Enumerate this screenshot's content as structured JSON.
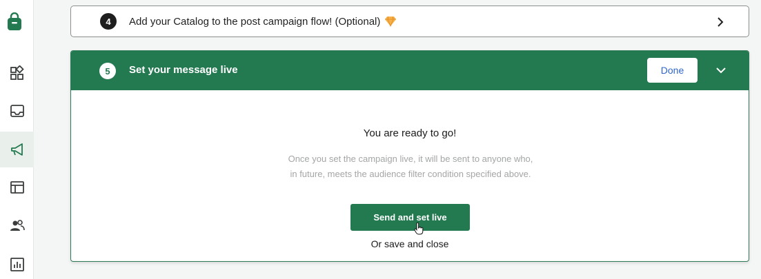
{
  "sidebar": {
    "logo_icon": "shopping-bag-icon",
    "items": [
      {
        "icon": "apps-grid-icon",
        "active": false
      },
      {
        "icon": "inbox-icon",
        "active": false
      },
      {
        "icon": "megaphone-icon",
        "active": true
      },
      {
        "icon": "table-icon",
        "active": false
      },
      {
        "icon": "users-icon",
        "active": false
      },
      {
        "icon": "bar-chart-icon",
        "active": false
      }
    ]
  },
  "steps": {
    "step4": {
      "number": "4",
      "title": "Add your Catalog to the post campaign flow! (Optional)",
      "badge_icon": "gem-icon"
    },
    "step5": {
      "number": "5",
      "title": "Set your message live",
      "done_label": "Done",
      "ready_title": "You are ready to go!",
      "ready_description": "Once you set the campaign live, it will be sent to anyone who, in future, meets the audience filter condition specified above.",
      "send_label": "Send and set live",
      "save_close_label": "Or save and close"
    }
  },
  "colors": {
    "accent": "#237950",
    "done_text": "#2f66c9",
    "muted_text": "#a3a6a5"
  }
}
